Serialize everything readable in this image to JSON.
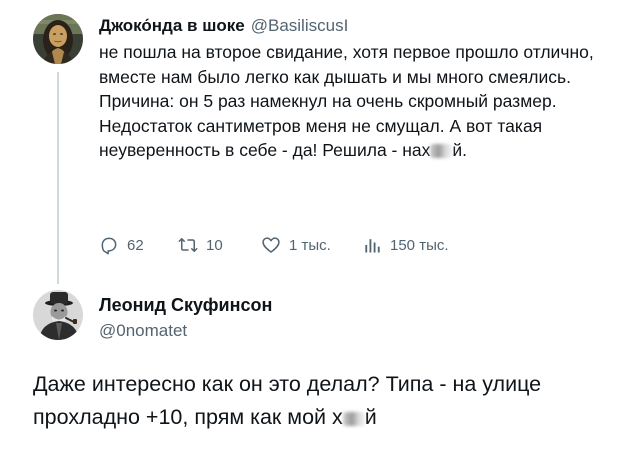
{
  "tweet1": {
    "author_name": "Джоко́нда в шоке",
    "author_handle": "@BasiliscusI",
    "paragraph1": "не пошла на второе свидание, хотя первое прошло отлично, вместе нам было легко как дышать и мы много смеялись.",
    "paragraph2_main": "Причина: он 5 раз намекнул на очень скромный размер. Недостаток сантиметров меня не смущал. А вот такая неуверенность в себе - да! Решила - нах",
    "paragraph2_tail": "й.",
    "stats": {
      "replies": "62",
      "retweets": "10",
      "likes": "1 тыс.",
      "views": "150 тыс."
    },
    "icons": [
      "reply-icon",
      "retweet-icon",
      "like-icon",
      "views-icon"
    ]
  },
  "tweet2": {
    "author_name": "Леонид Скуфинсон",
    "author_handle": "@0nomatet",
    "text_part1": "Даже интересно как он это делал? Типа - на улице прохладно +10, прям как мой х",
    "text_tail": "й"
  },
  "colors": {
    "text_primary": "#0f1419",
    "text_secondary": "#536471",
    "thread_line": "#cfd9de",
    "background": "#ffffff"
  }
}
